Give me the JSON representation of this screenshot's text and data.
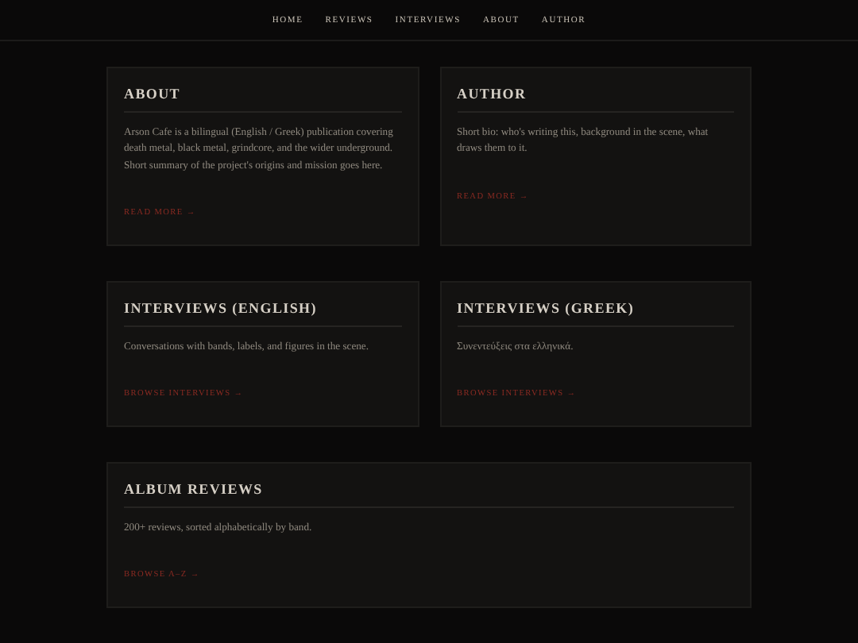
{
  "nav": {
    "items": [
      "HOME",
      "REVIEWS",
      "INTERVIEWS",
      "ABOUT",
      "AUTHOR"
    ]
  },
  "rows": [
    {
      "cards": [
        {
          "title": "ABOUT",
          "text": "Arson Cafe is a bilingual (English / Greek) publication covering death metal, black metal, grindcore, and the wider underground. Short summary of the project's origins and mission goes here.",
          "link": "READ MORE →"
        },
        {
          "title": "AUTHOR",
          "text": "Short bio: who's writing this, background in the scene, what draws them to it.",
          "link": "READ MORE →"
        }
      ]
    },
    {
      "cards": [
        {
          "title": "INTERVIEWS (ENGLISH)",
          "text": "Conversations with bands, labels, and figures in the scene.",
          "link": "BROWSE INTERVIEWS →"
        },
        {
          "title": "INTERVIEWS (GREEK)",
          "text": "Συνεντεύξεις στα ελληνικά.",
          "link": "BROWSE INTERVIEWS →"
        }
      ]
    },
    {
      "cards": [
        {
          "title": "ALBUM REVIEWS",
          "text": "200+ reviews, sorted alphabetically by band.",
          "link": "BROWSE A–Z →"
        }
      ]
    }
  ]
}
